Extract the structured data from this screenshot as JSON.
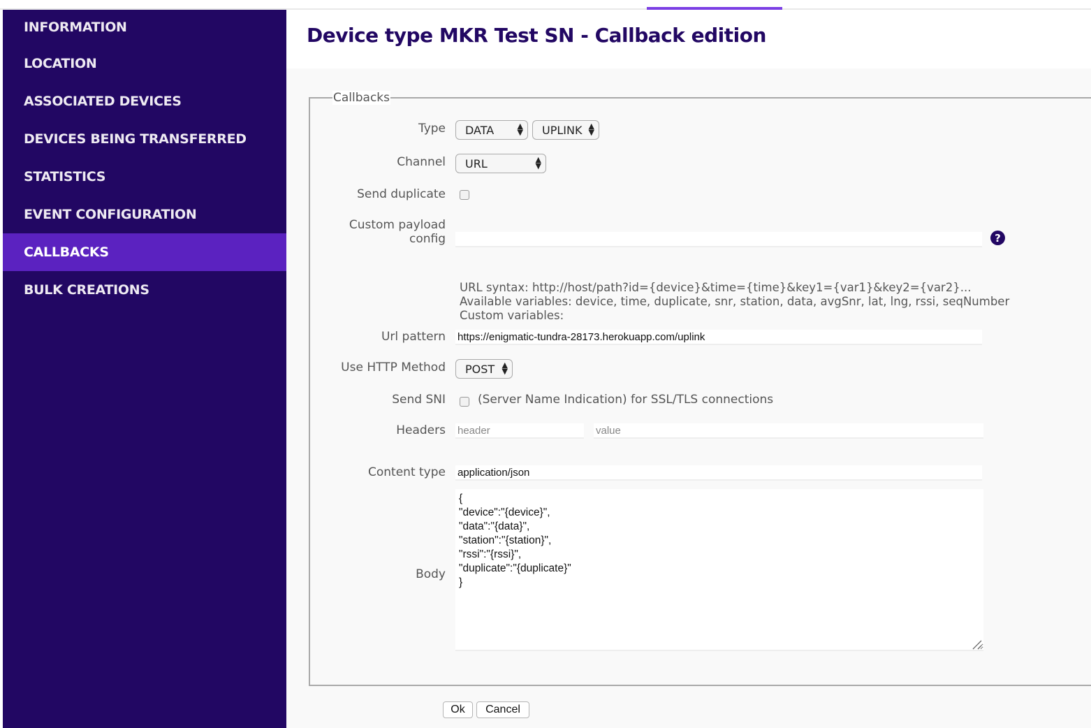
{
  "page": {
    "title": "Device type MKR Test SN - Callback edition"
  },
  "sidebar": {
    "items": [
      {
        "label": "INFORMATION",
        "active": false
      },
      {
        "label": "LOCATION",
        "active": false
      },
      {
        "label": "ASSOCIATED DEVICES",
        "active": false
      },
      {
        "label": "DEVICES BEING TRANSFERRED",
        "active": false
      },
      {
        "label": "STATISTICS",
        "active": false
      },
      {
        "label": "EVENT CONFIGURATION",
        "active": false
      },
      {
        "label": "CALLBACKS",
        "active": true
      },
      {
        "label": "BULK CREATIONS",
        "active": false
      }
    ]
  },
  "form": {
    "legend": "Callbacks",
    "type": {
      "label": "Type",
      "value": "DATA",
      "subtype": "UPLINK"
    },
    "channel": {
      "label": "Channel",
      "value": "URL"
    },
    "send_duplicate": {
      "label": "Send duplicate",
      "checked": false
    },
    "custom_payload": {
      "label_line1": "Custom payload",
      "label_line2": "config",
      "value": "",
      "help_icon": "question-circle-icon"
    },
    "help": {
      "line1": "URL syntax: http://host/path?id={device}&time={time}&key1={var1}&key2={var2}...",
      "line2": "Available variables: device, time, duplicate, snr, station, data, avgSnr, lat, lng, rssi, seqNumber",
      "line3": "Custom variables:"
    },
    "url_pattern": {
      "label": "Url pattern",
      "value": "https://enigmatic-tundra-28173.herokuapp.com/uplink"
    },
    "http_method": {
      "label": "Use HTTP Method",
      "value": "POST"
    },
    "send_sni": {
      "label": "Send SNI",
      "checked": false,
      "description": "(Server Name Indication) for SSL/TLS connections"
    },
    "headers": {
      "label": "Headers",
      "header_placeholder": "header",
      "value_placeholder": "value"
    },
    "content_type": {
      "label": "Content type",
      "value": "application/json"
    },
    "body": {
      "label": "Body",
      "value": "{\n\"device\":\"{device}\",\n\"data\":\"{data}\",\n\"station\":\"{station}\",\n\"rssi\":\"{rssi}\",\n\"duplicate\":\"{duplicate}\"\n}"
    }
  },
  "actions": {
    "ok_label": "Ok",
    "cancel_label": "Cancel"
  },
  "colors": {
    "sidebar_bg": "#220763",
    "sidebar_active": "#5b22c0",
    "accent": "#7b3fe4",
    "title": "#220763"
  }
}
